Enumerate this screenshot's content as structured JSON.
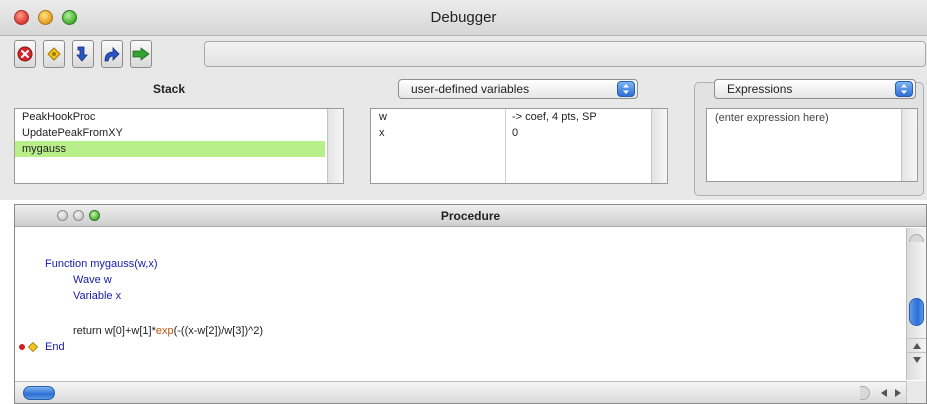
{
  "window": {
    "title": "Debugger"
  },
  "toolbar": {
    "buttons": [
      {
        "id": "stop",
        "icon": "stop-icon",
        "color": "#d8232a"
      },
      {
        "id": "step",
        "icon": "yellow-diamond-icon",
        "color": "#e0b020"
      },
      {
        "id": "step-into",
        "icon": "step-into-arrow-icon",
        "color": "#2a55c8"
      },
      {
        "id": "step-out",
        "icon": "step-out-arrow-icon",
        "color": "#2a55c8"
      },
      {
        "id": "go",
        "icon": "go-arrow-icon",
        "color": "#35a235"
      }
    ],
    "status_text": ""
  },
  "stack": {
    "title": "Stack",
    "items": [
      {
        "label": "PeakHookProc"
      },
      {
        "label": "UpdatePeakFromXY"
      },
      {
        "label": "mygauss",
        "selected": true
      }
    ]
  },
  "variables": {
    "selector": "user-defined variables",
    "rows": [
      {
        "name": "w",
        "value": "-> coef, 4 pts, SP"
      },
      {
        "name": "x",
        "value": "0"
      }
    ]
  },
  "expressions": {
    "selector": "Expressions",
    "placeholder": "(enter expression here)"
  },
  "procedure": {
    "title": "Procedure",
    "lines": {
      "l1": "Function mygauss(w,x)",
      "l2": "Wave w",
      "l3": "Variable x",
      "l4_a": "return w[0]+w[1]*",
      "l4_b": "exp",
      "l4_c": "(-((x-w[2])/w[3])^2)",
      "l5": "End"
    },
    "breakpoint_line": 4
  },
  "colors": {
    "selection": "#b8ef8a",
    "keyword": "#1a1aa8",
    "builtin": "#b8560a",
    "accent_blue": "#2c6fd6"
  }
}
